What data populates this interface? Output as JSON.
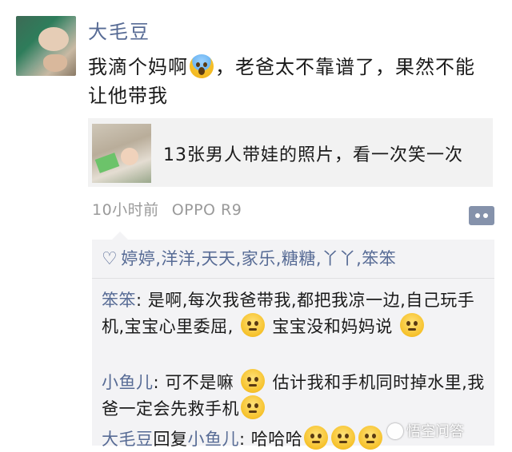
{
  "post": {
    "username": "大毛豆",
    "text_before_emoji": "我滴个妈啊",
    "emoji_1": "scream-emoji",
    "text_after_emoji": "，老爸太不靠谱了，果然不能让他带我"
  },
  "share_card": {
    "title": "13张男人带娃的照片，看一次笑一次"
  },
  "meta": {
    "time": "10小时前",
    "device": "OPPO R9"
  },
  "comments_box": {
    "likes": "婷婷,洋洋,天天,家乐,糖糖,丫丫,笨笨",
    "comments": [
      {
        "name": "笨笨",
        "text_a": ": 是啊,每次我爸带我,都把我凉一边,自己玩手机,宝宝心里委屈, ",
        "text_b": " 宝宝没和妈妈说",
        "emojis": [
          "awkward-emoji",
          "sad-emoji"
        ]
      },
      {
        "name": "小鱼儿",
        "text_a": ": 可不是嘛 ",
        "text_b": " 估计我和手机同时掉水里,我爸一定会先救手机",
        "emojis": [
          "awkward-emoji",
          "crying-emoji"
        ]
      },
      {
        "name": "大毛豆",
        "reply_word": "回复",
        "reply_to": "小鱼儿",
        "text_a": ": 哈哈哈",
        "emojis": [
          "grin-emoji",
          "grin-emoji",
          "grin-emoji"
        ]
      }
    ]
  },
  "watermark": "悟空问答"
}
